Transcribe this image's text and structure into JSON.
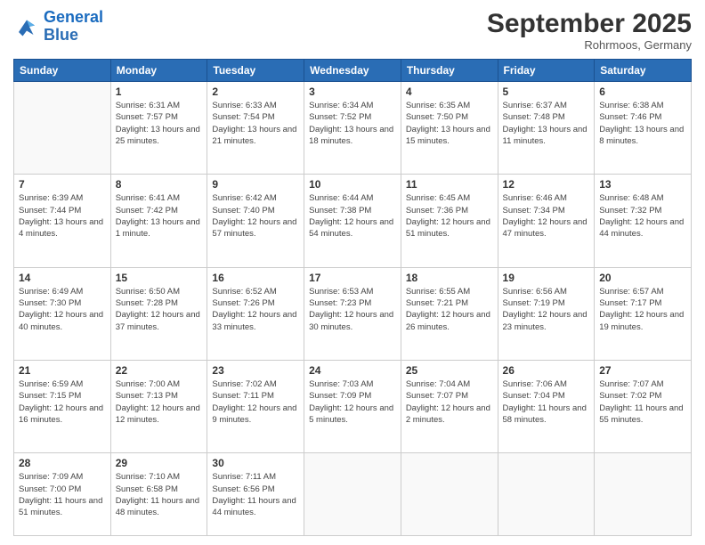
{
  "header": {
    "logo_general": "General",
    "logo_blue": "Blue",
    "month": "September 2025",
    "location": "Rohrmoos, Germany"
  },
  "days_of_week": [
    "Sunday",
    "Monday",
    "Tuesday",
    "Wednesday",
    "Thursday",
    "Friday",
    "Saturday"
  ],
  "weeks": [
    [
      {
        "day": "",
        "info": ""
      },
      {
        "day": "1",
        "info": "Sunrise: 6:31 AM\nSunset: 7:57 PM\nDaylight: 13 hours and 25 minutes."
      },
      {
        "day": "2",
        "info": "Sunrise: 6:33 AM\nSunset: 7:54 PM\nDaylight: 13 hours and 21 minutes."
      },
      {
        "day": "3",
        "info": "Sunrise: 6:34 AM\nSunset: 7:52 PM\nDaylight: 13 hours and 18 minutes."
      },
      {
        "day": "4",
        "info": "Sunrise: 6:35 AM\nSunset: 7:50 PM\nDaylight: 13 hours and 15 minutes."
      },
      {
        "day": "5",
        "info": "Sunrise: 6:37 AM\nSunset: 7:48 PM\nDaylight: 13 hours and 11 minutes."
      },
      {
        "day": "6",
        "info": "Sunrise: 6:38 AM\nSunset: 7:46 PM\nDaylight: 13 hours and 8 minutes."
      }
    ],
    [
      {
        "day": "7",
        "info": "Sunrise: 6:39 AM\nSunset: 7:44 PM\nDaylight: 13 hours and 4 minutes."
      },
      {
        "day": "8",
        "info": "Sunrise: 6:41 AM\nSunset: 7:42 PM\nDaylight: 13 hours and 1 minute."
      },
      {
        "day": "9",
        "info": "Sunrise: 6:42 AM\nSunset: 7:40 PM\nDaylight: 12 hours and 57 minutes."
      },
      {
        "day": "10",
        "info": "Sunrise: 6:44 AM\nSunset: 7:38 PM\nDaylight: 12 hours and 54 minutes."
      },
      {
        "day": "11",
        "info": "Sunrise: 6:45 AM\nSunset: 7:36 PM\nDaylight: 12 hours and 51 minutes."
      },
      {
        "day": "12",
        "info": "Sunrise: 6:46 AM\nSunset: 7:34 PM\nDaylight: 12 hours and 47 minutes."
      },
      {
        "day": "13",
        "info": "Sunrise: 6:48 AM\nSunset: 7:32 PM\nDaylight: 12 hours and 44 minutes."
      }
    ],
    [
      {
        "day": "14",
        "info": "Sunrise: 6:49 AM\nSunset: 7:30 PM\nDaylight: 12 hours and 40 minutes."
      },
      {
        "day": "15",
        "info": "Sunrise: 6:50 AM\nSunset: 7:28 PM\nDaylight: 12 hours and 37 minutes."
      },
      {
        "day": "16",
        "info": "Sunrise: 6:52 AM\nSunset: 7:26 PM\nDaylight: 12 hours and 33 minutes."
      },
      {
        "day": "17",
        "info": "Sunrise: 6:53 AM\nSunset: 7:23 PM\nDaylight: 12 hours and 30 minutes."
      },
      {
        "day": "18",
        "info": "Sunrise: 6:55 AM\nSunset: 7:21 PM\nDaylight: 12 hours and 26 minutes."
      },
      {
        "day": "19",
        "info": "Sunrise: 6:56 AM\nSunset: 7:19 PM\nDaylight: 12 hours and 23 minutes."
      },
      {
        "day": "20",
        "info": "Sunrise: 6:57 AM\nSunset: 7:17 PM\nDaylight: 12 hours and 19 minutes."
      }
    ],
    [
      {
        "day": "21",
        "info": "Sunrise: 6:59 AM\nSunset: 7:15 PM\nDaylight: 12 hours and 16 minutes."
      },
      {
        "day": "22",
        "info": "Sunrise: 7:00 AM\nSunset: 7:13 PM\nDaylight: 12 hours and 12 minutes."
      },
      {
        "day": "23",
        "info": "Sunrise: 7:02 AM\nSunset: 7:11 PM\nDaylight: 12 hours and 9 minutes."
      },
      {
        "day": "24",
        "info": "Sunrise: 7:03 AM\nSunset: 7:09 PM\nDaylight: 12 hours and 5 minutes."
      },
      {
        "day": "25",
        "info": "Sunrise: 7:04 AM\nSunset: 7:07 PM\nDaylight: 12 hours and 2 minutes."
      },
      {
        "day": "26",
        "info": "Sunrise: 7:06 AM\nSunset: 7:04 PM\nDaylight: 11 hours and 58 minutes."
      },
      {
        "day": "27",
        "info": "Sunrise: 7:07 AM\nSunset: 7:02 PM\nDaylight: 11 hours and 55 minutes."
      }
    ],
    [
      {
        "day": "28",
        "info": "Sunrise: 7:09 AM\nSunset: 7:00 PM\nDaylight: 11 hours and 51 minutes."
      },
      {
        "day": "29",
        "info": "Sunrise: 7:10 AM\nSunset: 6:58 PM\nDaylight: 11 hours and 48 minutes."
      },
      {
        "day": "30",
        "info": "Sunrise: 7:11 AM\nSunset: 6:56 PM\nDaylight: 11 hours and 44 minutes."
      },
      {
        "day": "",
        "info": ""
      },
      {
        "day": "",
        "info": ""
      },
      {
        "day": "",
        "info": ""
      },
      {
        "day": "",
        "info": ""
      }
    ]
  ]
}
